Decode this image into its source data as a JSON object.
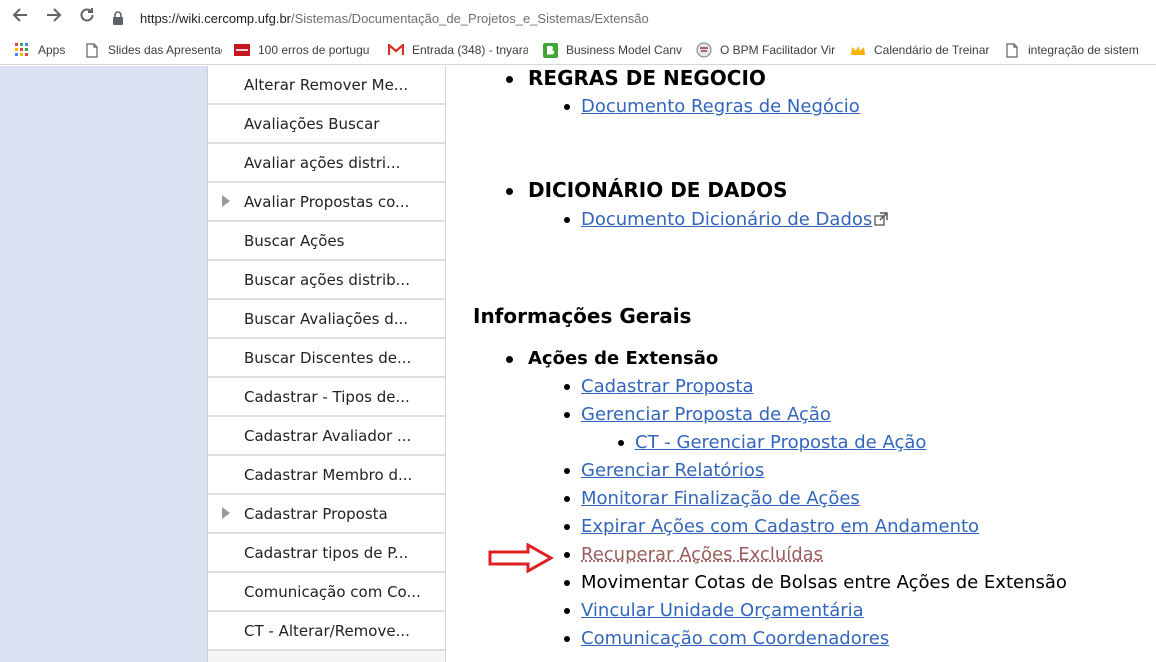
{
  "browser": {
    "url_host": "https://wiki.cercomp.ufg.br",
    "url_path": "/Sistemas/Documentação_de_Projetos_e_Sistemas/Extensão",
    "bookmarks": [
      {
        "label": "Apps",
        "icon": "apps-grid-icon"
      },
      {
        "label": "Slides das Apresentaç",
        "icon": "document-icon"
      },
      {
        "label": "100 erros de portugu",
        "icon": "red-book-icon"
      },
      {
        "label": "Entrada (348) - tnyara",
        "icon": "gmail-icon"
      },
      {
        "label": "Business Model Canv",
        "icon": "b-green-icon"
      },
      {
        "label": "O BPM Facilitador Vir",
        "icon": "bpm-icon"
      },
      {
        "label": "Calendário de Treinar",
        "icon": "crown-icon"
      },
      {
        "label": "integração de sistem",
        "icon": "document-icon"
      }
    ]
  },
  "sidebar": {
    "items": [
      {
        "label": "Alterar Remover Me...",
        "has_arrow": false
      },
      {
        "label": "Avaliações Buscar",
        "has_arrow": false
      },
      {
        "label": "Avaliar ações distri...",
        "has_arrow": false
      },
      {
        "label": "Avaliar Propostas co...",
        "has_arrow": true
      },
      {
        "label": "Buscar Ações",
        "has_arrow": false
      },
      {
        "label": "Buscar ações distrib...",
        "has_arrow": false
      },
      {
        "label": "Buscar Avaliações d...",
        "has_arrow": false
      },
      {
        "label": "Buscar Discentes de...",
        "has_arrow": false
      },
      {
        "label": "Cadastrar - Tipos de...",
        "has_arrow": false
      },
      {
        "label": "Cadastrar Avaliador ...",
        "has_arrow": false
      },
      {
        "label": "Cadastrar Membro d...",
        "has_arrow": false
      },
      {
        "label": "Cadastrar Proposta",
        "has_arrow": true
      },
      {
        "label": "Cadastrar tipos de P...",
        "has_arrow": false
      },
      {
        "label": "Comunicação com Co...",
        "has_arrow": false
      },
      {
        "label": "CT - Alterar/Remove...",
        "has_arrow": false
      }
    ]
  },
  "content": {
    "regras_heading": "REGRAS DE NEGOCIO",
    "regras_link": "Documento Regras de Negócio",
    "dicionario_heading": "DICIONÁRIO DE DADOS",
    "dicionario_link": "Documento Dicionário de Dados",
    "info_title": "Informações Gerais",
    "acoes_heading": "Ações de Extensão",
    "links": [
      {
        "text": "Cadastrar Proposta",
        "style": "link"
      },
      {
        "text": "Gerenciar Proposta de Ação",
        "style": "link"
      },
      {
        "text": "CT - Gerenciar Proposta de Ação",
        "style": "link"
      },
      {
        "text": "Gerenciar Relatórios",
        "style": "link"
      },
      {
        "text": "Monitorar Finalização de Ações",
        "style": "link"
      },
      {
        "text": "Expirar Ações com Cadastro em Andamento",
        "style": "link"
      },
      {
        "text": "Recuperar Ações Excluídas",
        "style": "visited"
      },
      {
        "text": "Movimentar Cotas de Bolsas entre Ações de Extensão",
        "style": "plain"
      },
      {
        "text": "Vincular Unidade Orçamentária",
        "style": "link"
      },
      {
        "text": "Comunicação com Coordenadores",
        "style": "link"
      }
    ]
  },
  "colors": {
    "link": "#3366bb",
    "visited_link": "#9a5d5d",
    "left_panel": "#dae1f0",
    "annotation_arrow": "#e02020"
  }
}
